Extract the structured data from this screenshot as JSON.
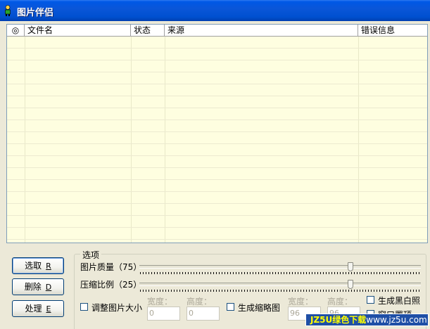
{
  "window": {
    "title": "图片伴侣",
    "icon": "person-app-icon"
  },
  "list": {
    "columns": [
      {
        "label": "◎"
      },
      {
        "label": "文件名"
      },
      {
        "label": "状态"
      },
      {
        "label": "来源"
      },
      {
        "label": "错误信息"
      }
    ],
    "rows": [],
    "background": "#fefee0"
  },
  "buttons": [
    {
      "label": "选取",
      "accel": "R"
    },
    {
      "label": "删除",
      "accel": "D"
    },
    {
      "label": "处理",
      "accel": "E"
    }
  ],
  "options": {
    "group_label": "选项",
    "quality": {
      "label": "图片质量（75）",
      "value": 75
    },
    "compression": {
      "label": "压缩比例（25）",
      "value": 25
    },
    "resize": {
      "label": "调整图片大小",
      "checked": false,
      "width_label": "宽度：",
      "width_value": "0",
      "height_label": "高度：",
      "height_value": "0"
    },
    "thumbnail": {
      "label": "生成缩略图",
      "checked": false,
      "width_label": "宽度：",
      "width_value": "96",
      "height_label": "高度：",
      "height_value": "96"
    },
    "grayscale": {
      "label": "生成黑白照",
      "checked": false
    },
    "window_top": {
      "label": "窗口置顶",
      "checked": false
    }
  },
  "watermark": {
    "part_a": "JZ5U绿色下载",
    "part_b": "www.jz5u.com"
  },
  "colors": {
    "title_bar": "#0054e3",
    "face": "#ece9d8",
    "watermark_bg": "#1f4fa6"
  }
}
